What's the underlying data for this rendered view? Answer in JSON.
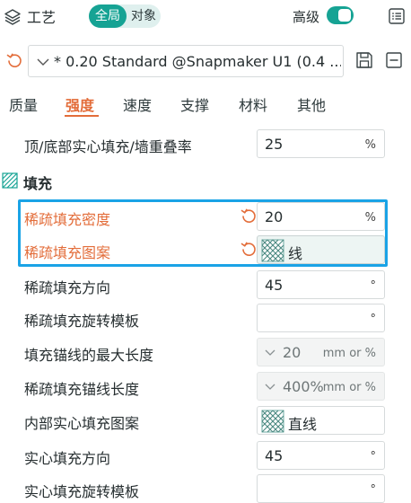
{
  "header": {
    "title": "工艺",
    "mode_global": "全局",
    "mode_object": "对象",
    "advanced_label": "高级",
    "advanced_on": true
  },
  "preset": {
    "name": "* 0.20 Standard @Snapmaker U1 (0.4 ..."
  },
  "tabs": [
    {
      "label": "质量",
      "active": false
    },
    {
      "label": "强度",
      "active": true
    },
    {
      "label": "速度",
      "active": false
    },
    {
      "label": "支撑",
      "active": false
    },
    {
      "label": "材料",
      "active": false
    },
    {
      "label": "其他",
      "active": false
    }
  ],
  "top_setting": {
    "label": "顶/底部实心填充/墙重叠率",
    "value": "25",
    "unit": "%"
  },
  "section": {
    "title": "填充"
  },
  "settings": [
    {
      "label": "稀疏填充密度",
      "value": "20",
      "unit": "%",
      "modified": true
    },
    {
      "label": "稀疏填充图案",
      "value": "线",
      "unit": "",
      "modified": true
    },
    {
      "label": "稀疏填充方向",
      "value": "45",
      "unit": "°"
    },
    {
      "label": "稀疏填充旋转模板",
      "value": "",
      "unit": "°"
    },
    {
      "label": "填充锚线的最大长度",
      "value": "20",
      "unit": "mm or %"
    },
    {
      "label": "稀疏填充锚线长度",
      "value": "400%",
      "unit": "mm or %"
    },
    {
      "label": "内部实心填充图案",
      "value": "直线",
      "unit": ""
    },
    {
      "label": "实心填充方向",
      "value": "45",
      "unit": "°"
    },
    {
      "label": "实心填充旋转模板",
      "value": "",
      "unit": "°"
    }
  ],
  "colors": {
    "accent": "#16a394",
    "modified": "#e36d3a",
    "highlight": "#1aa3e6"
  }
}
